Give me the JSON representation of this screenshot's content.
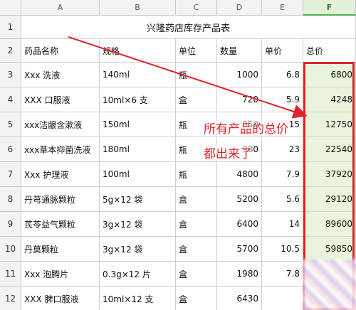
{
  "columns": [
    "A",
    "B",
    "C",
    "D",
    "E",
    "F"
  ],
  "title": "兴隆药店库存产品表",
  "header_row": [
    "药品名称",
    "规格",
    "单位",
    "数量",
    "单价",
    "总价"
  ],
  "rows": [
    {
      "num": "1"
    },
    {
      "num": "2"
    },
    {
      "num": "3",
      "cells": [
        "Xxx 洗液",
        "140ml",
        "瓶",
        "1000",
        "6.8",
        "6800"
      ]
    },
    {
      "num": "4",
      "cells": [
        " XXX 口服液",
        " 10ml×6 支",
        "盒",
        "720",
        "5.9",
        "4248"
      ]
    },
    {
      "num": "5",
      "cells": [
        " xxx洁龈含漱液",
        "150ml",
        "瓶",
        "850",
        "15",
        "12750"
      ]
    },
    {
      "num": "6",
      "cells": [
        "xxx草本抑菌洗液",
        "180ml",
        "瓶",
        "980",
        "23",
        "22540"
      ]
    },
    {
      "num": "7",
      "cells": [
        "Xxx 护理液",
        "100ml",
        "瓶",
        "4800",
        "7.9",
        "37920"
      ]
    },
    {
      "num": "8",
      "cells": [
        "丹芎通脉颗粒",
        "5g×12 袋",
        "盒",
        "5200",
        "5.6",
        "29120"
      ]
    },
    {
      "num": "9",
      "cells": [
        "芪苓益气颗粒",
        "3g×12 袋",
        "盒",
        "6400",
        "14",
        "89600"
      ]
    },
    {
      "num": "10",
      "cells": [
        "丹莫颗粒",
        "3g×12 袋",
        "盒",
        "5700",
        "10.5",
        "59850"
      ]
    },
    {
      "num": "11",
      "cells": [
        "Xxx 泡腾片",
        "0.3g×12 片",
        "盒",
        "1980",
        "7.8",
        ""
      ]
    },
    {
      "num": "12",
      "cells": [
        "XXX 脾口服液",
        "10ml×12 支",
        "盒",
        "6430",
        "",
        ""
      ]
    }
  ],
  "annotation": {
    "line1": "所有产品的总价",
    "line2": "都出来了",
    "color": "#e0222a"
  },
  "selected_column": "F"
}
